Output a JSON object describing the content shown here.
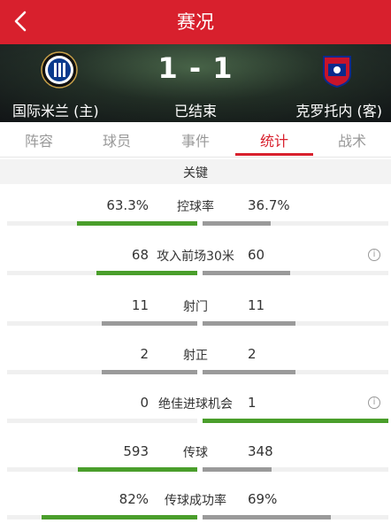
{
  "header": {
    "title": "赛况",
    "back_icon": "chevron-left-icon"
  },
  "match": {
    "score": "1 - 1",
    "status": "已结束",
    "home": {
      "name": "国际米兰 (主)",
      "crest_icon": "inter-milan-crest"
    },
    "away": {
      "name": "克罗托内 (客)",
      "crest_icon": "crotone-crest"
    }
  },
  "tabs": [
    {
      "label": "阵容"
    },
    {
      "label": "球员"
    },
    {
      "label": "事件"
    },
    {
      "label": "统计",
      "active": true
    },
    {
      "label": "战术"
    }
  ],
  "section": {
    "title": "关键"
  },
  "stats": [
    {
      "label": "控球率",
      "home": "63.3%",
      "away": "36.7%",
      "home_share": 0.633,
      "away_share": 0.367,
      "info": false
    },
    {
      "label": "攻入前场30米",
      "home": "68",
      "away": "60",
      "home_share": 0.53,
      "away_share": 0.47,
      "info": true
    },
    {
      "label": "射门",
      "home": "11",
      "away": "11",
      "home_share": 0.5,
      "away_share": 0.5,
      "info": false
    },
    {
      "label": "射正",
      "home": "2",
      "away": "2",
      "home_share": 0.5,
      "away_share": 0.5,
      "info": false
    },
    {
      "label": "绝佳进球机会",
      "home": "0",
      "away": "1",
      "home_share": 0.0,
      "away_share": 1.0,
      "info": true
    },
    {
      "label": "传球",
      "home": "593",
      "away": "348",
      "home_share": 0.63,
      "away_share": 0.37,
      "info": false
    },
    {
      "label": "传球成功率",
      "home": "82%",
      "away": "69%",
      "home_share": 0.82,
      "away_share": 0.69,
      "info": false
    }
  ],
  "colors": {
    "brand": "#d8202d",
    "winner_bar": "#4a9e2b",
    "loser_bar": "#9a9a9a"
  },
  "info_icon": "info-circle-icon"
}
